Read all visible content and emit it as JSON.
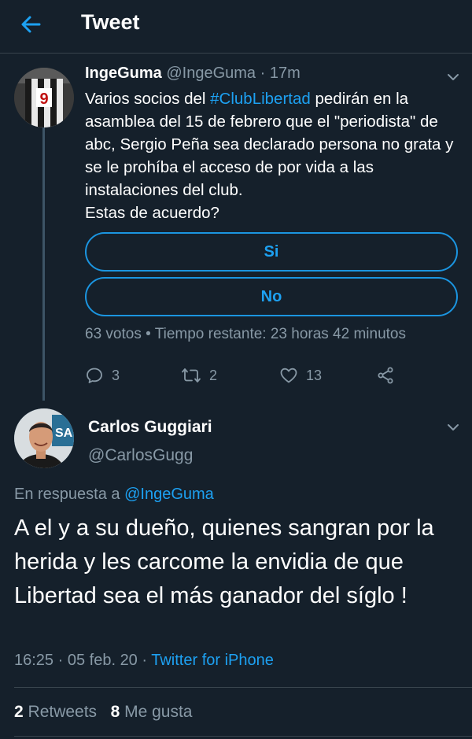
{
  "header": {
    "title": "Tweet",
    "back_icon": "arrow-left-icon"
  },
  "parent_tweet": {
    "name": "IngeGuma",
    "handle": "@IngeGuma",
    "separator": " · ",
    "time": "17m",
    "text_before": "Varios socios del ",
    "hashtag": "#ClubLibertad",
    "text_after": " pedirán en la asamblea del 15 de febrero que el \"periodista\" de abc, Sergio Peña sea declarado persona no grata y se le prohíba el acceso de por vida a las instalaciones del club.\nEstas de acuerdo?",
    "poll": {
      "options": [
        "Si",
        "No"
      ],
      "votes": "63 votos",
      "bullet": " • ",
      "time_left": "Tiempo restante: 23 horas 42 minutos"
    },
    "actions": {
      "replies": "3",
      "retweets": "2",
      "likes": "13"
    }
  },
  "reply_tweet": {
    "name": "Carlos Guggiari",
    "handle": "@CarlosGugg",
    "in_reply_prefix": "En respuesta a ",
    "in_reply_to": "@IngeGuma",
    "text": "A el y a su dueño, quienes sangran por la herida y les carcome la envidia de que Libertad sea el más ganador del síglo !",
    "time": "16:25",
    "sep1": " · ",
    "date": "05 feb. 20",
    "sep2": " · ",
    "source": "Twitter for iPhone",
    "retweets_count": "2",
    "retweets_label": " Retweets",
    "likes_count": "8",
    "likes_label": " Me gusta"
  },
  "colors": {
    "background": "#15202b",
    "accent": "#1da1f2",
    "secondary_text": "#8899a6",
    "border": "#38444d"
  }
}
